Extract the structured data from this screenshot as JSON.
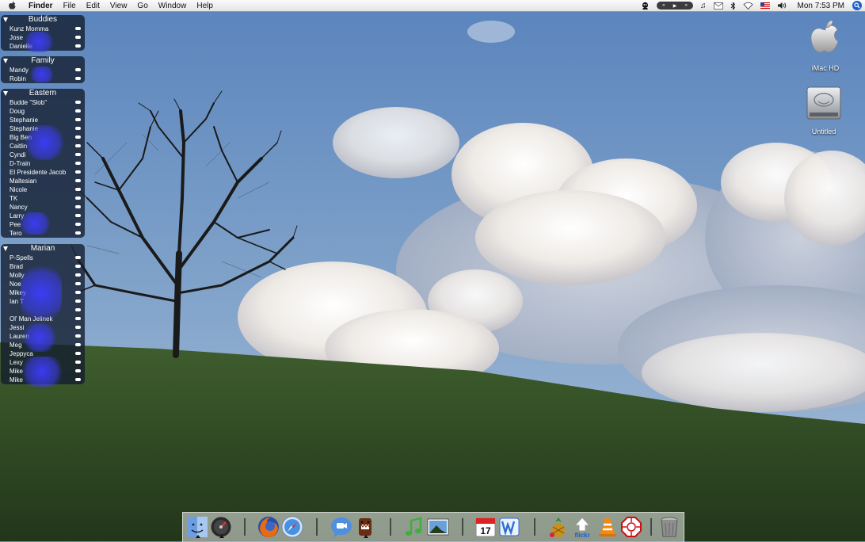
{
  "menubar": {
    "app_name": "Finder",
    "menus": [
      "File",
      "Edit",
      "View",
      "Go",
      "Window",
      "Help"
    ],
    "clock": "Mon 7:53 PM",
    "itunes_controls": [
      "«",
      "▶",
      "»"
    ]
  },
  "buddy_list": {
    "groups": [
      {
        "name": "Buddies",
        "buddies": [
          "Kunz Momma",
          "Jose",
          "Danielle"
        ]
      },
      {
        "name": "Family",
        "buddies": [
          "Mandy",
          "Robin"
        ]
      },
      {
        "name": "Eastern",
        "buddies": [
          "Budde \"Slob\"",
          "Doug",
          "Stephanie",
          "Stephanie",
          "Big Ben",
          "Caitlin",
          "Cyndi",
          "D-Train",
          "El Presidente Jacob",
          "Maltesian",
          "Nicole",
          "TK",
          "Nancy",
          "Larry",
          "Pee",
          "Tero"
        ]
      },
      {
        "name": "Marian",
        "buddies": [
          "P-Spells",
          "Brad",
          "Molly",
          "Noe",
          "Mikey",
          "Ian T",
          "",
          "Ol' Man Jelinek",
          "Jessi",
          "Lauren",
          "Meg",
          "Jeppyca",
          "Lexy",
          "Mike",
          "Mike"
        ]
      }
    ]
  },
  "desktop_icons": [
    {
      "label": "iMac HD",
      "icon": "apple-drive-icon"
    },
    {
      "label": "Untitled",
      "icon": "hard-disk-icon"
    }
  ],
  "dock_items": [
    "finder-icon",
    "dashboard-icon",
    "firefox-icon",
    "safari-icon",
    "ichat-icon",
    "domo-icon",
    "itunes-icon",
    "iphoto-icon",
    "ical-icon",
    "word-icon",
    "pineapple-app-icon",
    "flickr-uploader-icon",
    "vlc-icon",
    "dharma-icon",
    "trash-icon"
  ],
  "ical_date": "17",
  "flickr_label": "flickr",
  "colors": {
    "sky_top": "#6a90c4",
    "grass": "#2f4a22",
    "buddy_panel": "#141e30",
    "smudge": "#3c3cff"
  }
}
